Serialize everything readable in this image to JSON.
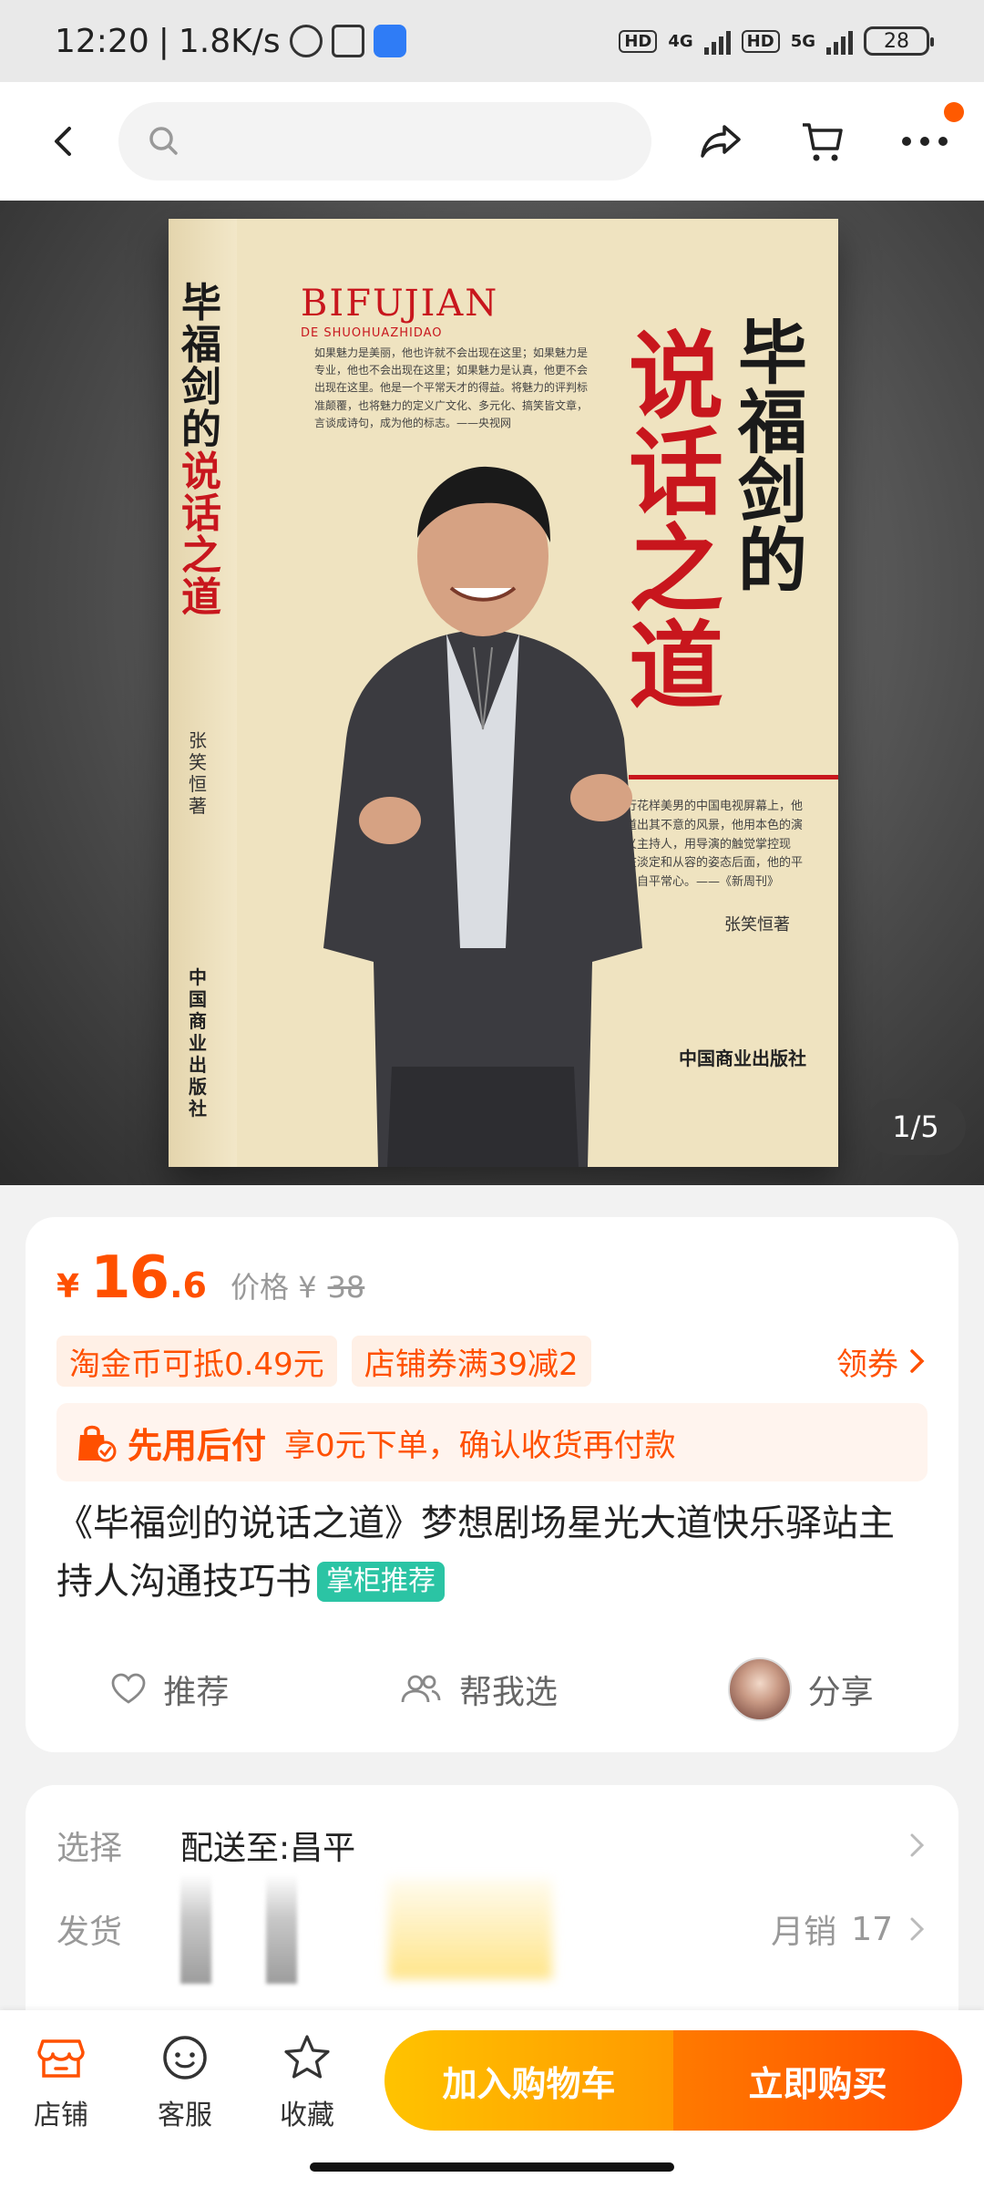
{
  "status_bar": {
    "time": "12:20",
    "speed": "1.8K/s",
    "net1": "4G",
    "net2": "5G",
    "hd": "HD",
    "battery": "28"
  },
  "header": {
    "search_placeholder": ""
  },
  "hero": {
    "page_indicator": "1/5",
    "book": {
      "spine_title_black": "毕福剑的",
      "spine_title_red": "说话之道",
      "spine_author": "张笑恒著",
      "spine_publisher": "中国商业出版社",
      "cover_en_title": "BIFUJIAN",
      "cover_en_sub": "DE SHUOHUAZHIDAO",
      "cover_title_black": "毕福剑的",
      "cover_title_red": "说话之道",
      "cover_quote": "如果魅力是美丽，他也许就不会出现在这里；如果魅力是专业，他也不会出现在这里；如果魅力是认真，他更不会出现在这里。他是一个平常天才的得益。将魅力的评判标准颠覆，也将魅力的定义广文化、多元化、搞笑皆文章，言谈成诗句，成为他的标志。——央视网",
      "cover_desc": "在流行花样美男的中国电视屏幕上，他是一道出其不意的风景，他用本色的演出定义主持人，用导演的触觉掌控现场，在淡定和从容的姿态后面，他的平民化缘自平常心。——《新周刊》",
      "cover_author": "张笑恒著",
      "cover_publisher": "中国商业出版社"
    }
  },
  "price_card": {
    "currency": "¥",
    "price_int": "16",
    "price_dec": ".6",
    "orig_label": "价格 ¥",
    "orig_price": "38",
    "coupons": [
      "淘金币可抵0.49元",
      "店铺券满39减2"
    ],
    "coupon_link": "领券",
    "paylater_brand": "先用后付",
    "paylater_desc": "享0元下单，确认收货再付款",
    "title": "《毕福剑的说话之道》梦想剧场星光大道快乐驿站主持人沟通技巧书",
    "title_tag": "掌柜推荐",
    "actions": {
      "recommend": "推荐",
      "help_choose": "帮我选",
      "share": "分享"
    }
  },
  "delivery_card": {
    "select_label": "选择",
    "select_value": "配送至:昌平",
    "ship_label": "发货",
    "monthly_label": "月销",
    "monthly_value": "17"
  },
  "bottom_bar": {
    "shop": "店铺",
    "service": "客服",
    "favorite": "收藏",
    "add_cart": "加入购物车",
    "buy_now": "立即购买"
  },
  "colors": {
    "accent": "#ff5000",
    "cart_button": "#ffb000",
    "buy_button": "#ff5a00",
    "tag_green": "#2bc4a4"
  }
}
